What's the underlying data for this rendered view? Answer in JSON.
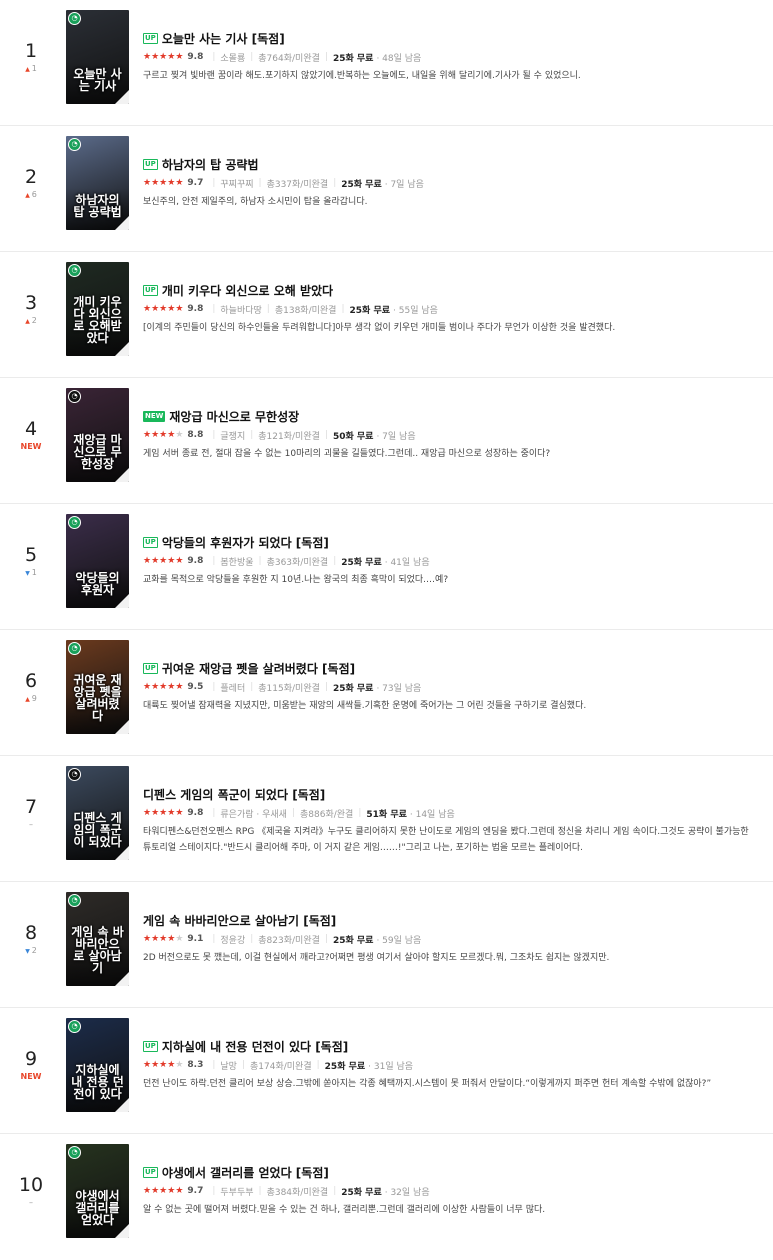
{
  "items": [
    {
      "rank": "1",
      "change": "1",
      "change_dir": "up",
      "tag": "UP",
      "tag_type": "up",
      "title": "오늘만 사는 기사 [독점]",
      "score": "9.8",
      "stars_on": 5,
      "author": "소몰룡",
      "total": "총764화/미완결",
      "free": "25화 무료",
      "remain": "· 48일 남음",
      "desc": "구르고 찢겨 빛바랜 꿈이라 해도.포기하지 않았기에.반복하는 오늘에도, 내일을 위해 달리기에.기사가 될 수 있었으니.",
      "cover_text": "오늘만 사는 기사",
      "cover_color": "#2b2f36",
      "badge": "green"
    },
    {
      "rank": "2",
      "change": "6",
      "change_dir": "up",
      "tag": "UP",
      "tag_type": "up",
      "title": "하남자의 탑 공략법",
      "score": "9.7",
      "stars_on": 5,
      "author": "꾸찌꾸찌",
      "total": "총337화/미완결",
      "free": "25화 무료",
      "remain": "· 7일 남음",
      "desc": "보신주의, 안전 제일주의, 하남자 소시민이 탑을 올라갑니다.",
      "cover_text": "하남자의 탑 공략법",
      "cover_color": "#5b6b8a",
      "badge": "green"
    },
    {
      "rank": "3",
      "change": "2",
      "change_dir": "up",
      "tag": "UP",
      "tag_type": "up",
      "title": "개미 키우다 외신으로 오해 받았다",
      "score": "9.8",
      "stars_on": 5,
      "author": "하늘바다땅",
      "total": "총138화/미완결",
      "free": "25화 무료",
      "remain": "· 55일 남음",
      "desc": "[이계의 주민들이 당신의 하수인들을 두려워합니다]아무 생각 없이 키우던 개미들 범이나 주다가 무언가 이상한 것을 발견했다.",
      "cover_text": "개미 키우다 외신으로 오해받았다",
      "cover_color": "#1f2a22",
      "badge": "green"
    },
    {
      "rank": "4",
      "change": "NEW",
      "change_dir": "new",
      "tag": "NEW",
      "tag_type": "new",
      "title": "재앙급 마신으로 무한성장",
      "score": "8.8",
      "stars_on": 4,
      "author": "글쟁지",
      "total": "총121화/미완결",
      "free": "50화 무료",
      "remain": "· 7일 남음",
      "desc": "게임 서버 종료 전, 절대 잡을 수 없는 10마리의 괴물을 길들였다.그런데.. 재앙급 마신으로 성장하는 중이다?",
      "cover_text": "재앙급 마신으로 무한성장",
      "cover_color": "#3a2436",
      "badge": "black"
    },
    {
      "rank": "5",
      "change": "1",
      "change_dir": "down",
      "tag": "UP",
      "tag_type": "up",
      "title": "악당들의 후원자가 되었다 [독점]",
      "score": "9.8",
      "stars_on": 5,
      "author": "봄한방울",
      "total": "총363화/미완결",
      "free": "25화 무료",
      "remain": "· 41일 남음",
      "desc": "교화를 목적으로 악당들을 후원한 지 10년.나는 왕국의 최종 흑막이 되었다.…예?",
      "cover_text": "악당들의 후원자",
      "cover_color": "#3b2d4a",
      "badge": "green"
    },
    {
      "rank": "6",
      "change": "9",
      "change_dir": "up",
      "tag": "UP",
      "tag_type": "up",
      "title": "귀여운 재앙급 펫을 살려버렸다 [독점]",
      "score": "9.5",
      "stars_on": 5,
      "author": "플레터",
      "total": "총115화/미완결",
      "free": "25화 무료",
      "remain": "· 73일 남음",
      "desc": "대륙도 찢어낼 잠재력을 지녔지만, 미움받는 재앙의 새싹들.기혹한 운명에 죽어가는 그 어린 것들을 구하기로 결심했다.",
      "cover_text": "귀여운 재앙급 펫을 살려버렸다",
      "cover_color": "#6b3a1e",
      "badge": "green"
    },
    {
      "rank": "7",
      "change": "–",
      "change_dir": "same",
      "tag": "",
      "tag_type": "none",
      "title": "디펜스 게임의 폭군이 되었다 [독점]",
      "score": "9.8",
      "stars_on": 5,
      "author": "류은가람 · 우새새",
      "total": "총886화/완결",
      "free": "51화 무료",
      "remain": "· 14일 남음",
      "desc": "타워디펜스&던전오펜스 RPG 《제국을 지켜라》누구도 클리어하지 못한 난이도로 게임의 엔딩을 봤다.그런데 정신을 차리니 게임 속이다.그것도 공략이 불가능한 튜토리얼 스테이지다.\"반드시 클리어해 주마, 이 거지 같은 게임……!\"그리고 나는, 포기하는 법을 모르는 플레이어다.",
      "cover_text": "디펜스 게임의 폭군이 되었다",
      "cover_color": "#3c4a5e",
      "badge": "black"
    },
    {
      "rank": "8",
      "change": "2",
      "change_dir": "down",
      "tag": "",
      "tag_type": "none",
      "title": "게임 속 바바리안으로 살아남기 [독점]",
      "score": "9.1",
      "stars_on": 4,
      "author": "정윤강",
      "total": "총823화/미완결",
      "free": "25화 무료",
      "remain": "· 59일 남음",
      "desc": "2D 버전으로도 못 깼는데, 이걸 현실에서 깨라고?어쩌면 평생 여기서 살아야 할지도 모르겠다.뭐, 그조차도 쉽지는 않겠지만.",
      "cover_text": "게임 속 바바리안으로 살아남기",
      "cover_color": "#2e2b28",
      "badge": "green"
    },
    {
      "rank": "9",
      "change": "NEW",
      "change_dir": "new",
      "tag": "UP",
      "tag_type": "up",
      "title": "지하실에 내 전용 던전이 있다 [독점]",
      "score": "8.3",
      "stars_on": 4,
      "author": "날망",
      "total": "총174화/미완결",
      "free": "25화 무료",
      "remain": "· 31일 남음",
      "desc": "던전 난이도 하락.던전 클리어 보상 상승.그밖에 쏟아지는 각종 혜택까지.시스템이 못 퍼줘서 안달이다.“이렇게까지 퍼주면 헌터 계속할 수밖에 없잖아?”",
      "cover_text": "지하실에 내 전용 던전이 있다",
      "cover_color": "#1c2c4a",
      "badge": "green"
    },
    {
      "rank": "10",
      "change": "–",
      "change_dir": "same",
      "tag": "UP",
      "tag_type": "up",
      "title": "야생에서 갤러리를 얻었다 [독점]",
      "score": "9.7",
      "stars_on": 5,
      "author": "두부두부",
      "total": "총384화/미완결",
      "free": "25화 무료",
      "remain": "· 32일 남음",
      "desc": "알 수 없는 곳에 떨어져 버렸다.믿을 수 있는 건 하나, 갤러리뿐.그런데 갤러리에 이상한 사람들이 너무 많다.",
      "cover_text": "야생에서 갤러리를 얻었다",
      "cover_color": "#26331f",
      "badge": "green"
    }
  ]
}
